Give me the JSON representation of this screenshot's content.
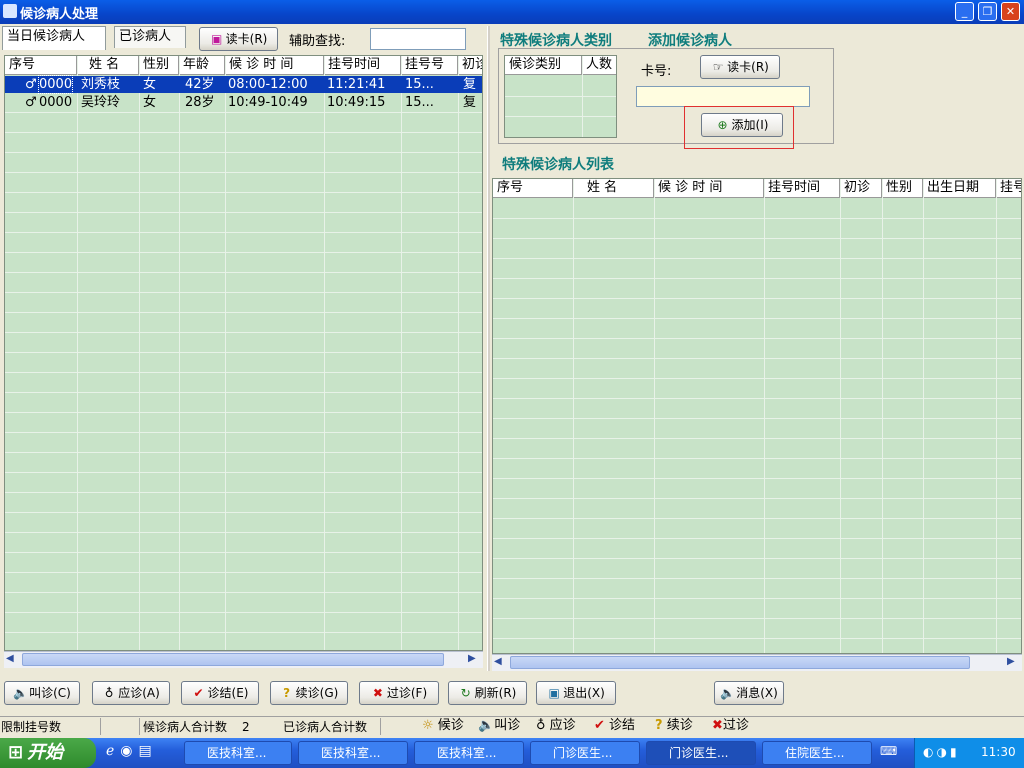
{
  "window": {
    "title": "候诊病人处理"
  },
  "toolbar": {
    "tab_today": "当日候诊病人",
    "tab_seen": "已诊病人",
    "read_card_label": "读卡(R)",
    "search_label": "辅助查找:",
    "search_value": ""
  },
  "left_table": {
    "columns": [
      "序号",
      "姓 名",
      "性别",
      "年龄",
      "候 诊 时 间",
      "挂号时间",
      "挂号号",
      "初诊"
    ],
    "rows": [
      {
        "seq": "0000",
        "name": "刘秀枝",
        "sex": "女",
        "age": "42岁",
        "wait": "08:00-12:00",
        "reg_time": "11:21:41",
        "reg_no": "15...",
        "first": "复"
      },
      {
        "seq": "0000",
        "name": "吴玲玲",
        "sex": "女",
        "age": "28岁",
        "wait": "10:49-10:49",
        "reg_time": "10:49:15",
        "reg_no": "15...",
        "first": "复"
      }
    ]
  },
  "special": {
    "category_title": "特殊候诊病人类别",
    "add_title": "添加候诊病人",
    "category_columns": [
      "候诊类别",
      "人数"
    ],
    "card_label": "卡号:",
    "read_card_label": "读卡(R)",
    "card_value": "",
    "add_button": "添加(I)",
    "list_title": "特殊候诊病人列表",
    "list_columns": [
      "序号",
      "姓 名",
      "候 诊 时 间",
      "挂号时间",
      "初诊",
      "性别",
      "出生日期",
      "挂号"
    ]
  },
  "actions": {
    "call": "叫诊(C)",
    "answer": "应诊(A)",
    "finish": "诊结(E)",
    "continue": "续诊(G)",
    "pass": "过诊(F)",
    "refresh": "刷新(R)",
    "exit": "退出(X)",
    "message": "消息(X)"
  },
  "statusbar": {
    "limit": "限制挂号数",
    "waiting_total_label": "候诊病人合计数",
    "waiting_total": "2",
    "seen_total_label": "已诊病人合计数",
    "legend": [
      "候诊",
      "叫诊",
      "应诊",
      "诊结",
      "续诊",
      "过诊"
    ]
  },
  "taskbar": {
    "start": "开始",
    "tasks": [
      "医技科室...",
      "医技科室...",
      "医技科室...",
      "门诊医生...",
      "门诊医生...",
      "住院医生..."
    ],
    "clock": "11:30"
  }
}
